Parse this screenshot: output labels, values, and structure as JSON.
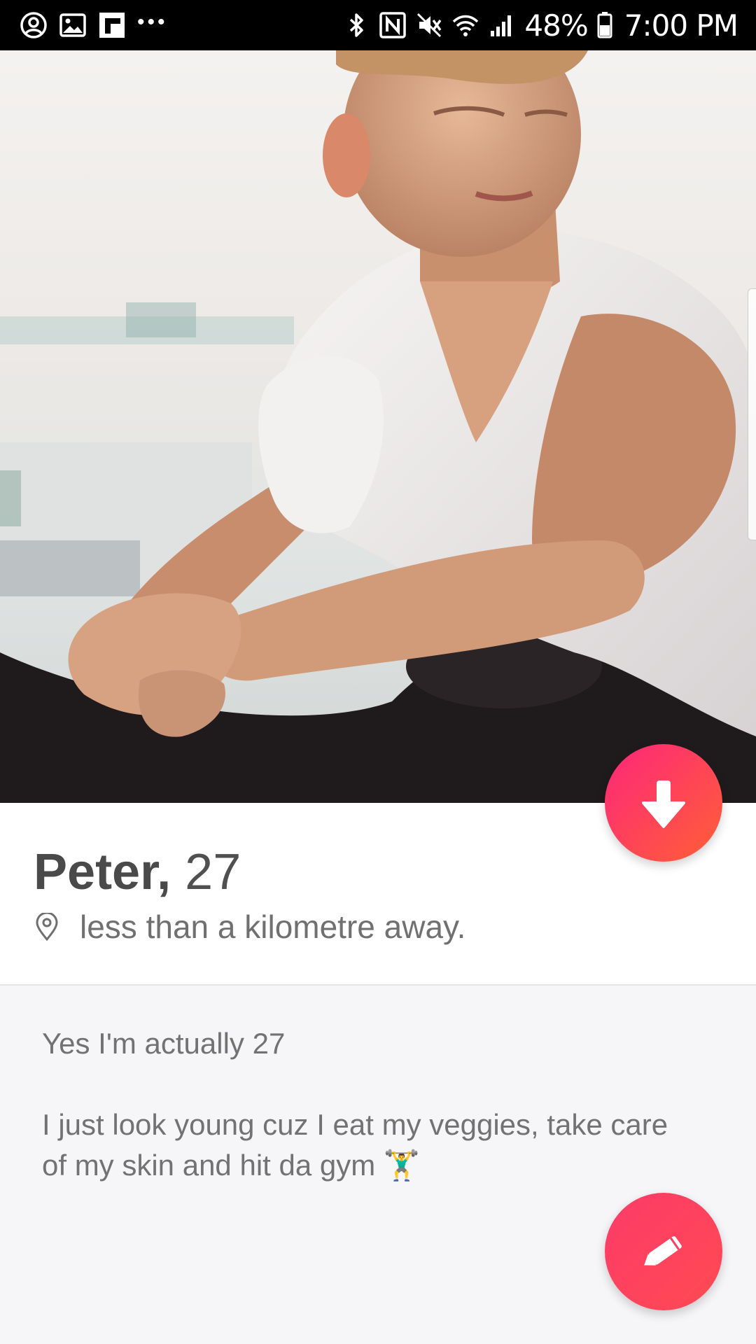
{
  "status_bar": {
    "battery": "48%",
    "time": "7:00 PM",
    "left_icons": [
      "account-icon",
      "gallery-icon",
      "flipboard-icon",
      "more-dots-icon"
    ],
    "right_icons": [
      "bluetooth-icon",
      "nfc-icon",
      "mute-icon",
      "wifi-icon",
      "signal-icon",
      "battery-icon"
    ]
  },
  "profile": {
    "name": "Peter,",
    "age": "27",
    "distance": "less than a kilometre away.",
    "photo": "profile-photo"
  },
  "bio": {
    "line1": "Yes I'm actually 27",
    "line2": "I just look young cuz I eat my veggies, take care of my skin and hit da gym",
    "emoji": "🏋️‍♂️"
  },
  "buttons": {
    "collapse": "arrow-down-icon",
    "edit": "pencil-icon"
  },
  "colors": {
    "gradient_start": "#fd267a",
    "gradient_end": "#ff6036",
    "edit_button": "#fd3e62"
  }
}
